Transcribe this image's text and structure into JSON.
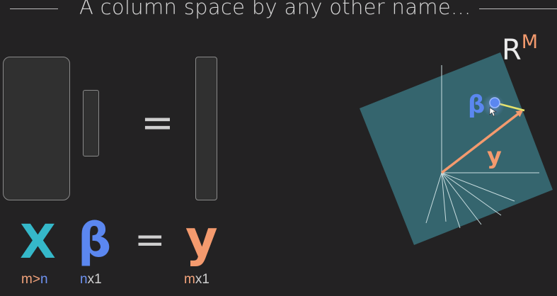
{
  "title": "A column space by any other name...",
  "equation": {
    "x_symbol": "X",
    "beta_symbol": "β",
    "equals": "=",
    "y_symbol": "y",
    "x_dims": {
      "m": "m",
      "sep": ">",
      "n": "n"
    },
    "beta_dims": {
      "n": "n",
      "rest": "x1"
    },
    "y_dims": {
      "m": "m",
      "rest": "x1"
    }
  },
  "space": {
    "label": "R",
    "superscript": "M",
    "beta_label": "β",
    "y_label": "y"
  },
  "colors": {
    "background": "#232223",
    "x_teal": "#35b8c9",
    "beta_blue": "#5b87f0",
    "y_orange": "#f49a6e",
    "plane": "#35656e",
    "residual": "#e7e36a",
    "dim_orange": "#f4a47c",
    "dim_blue": "#6f93f2"
  }
}
